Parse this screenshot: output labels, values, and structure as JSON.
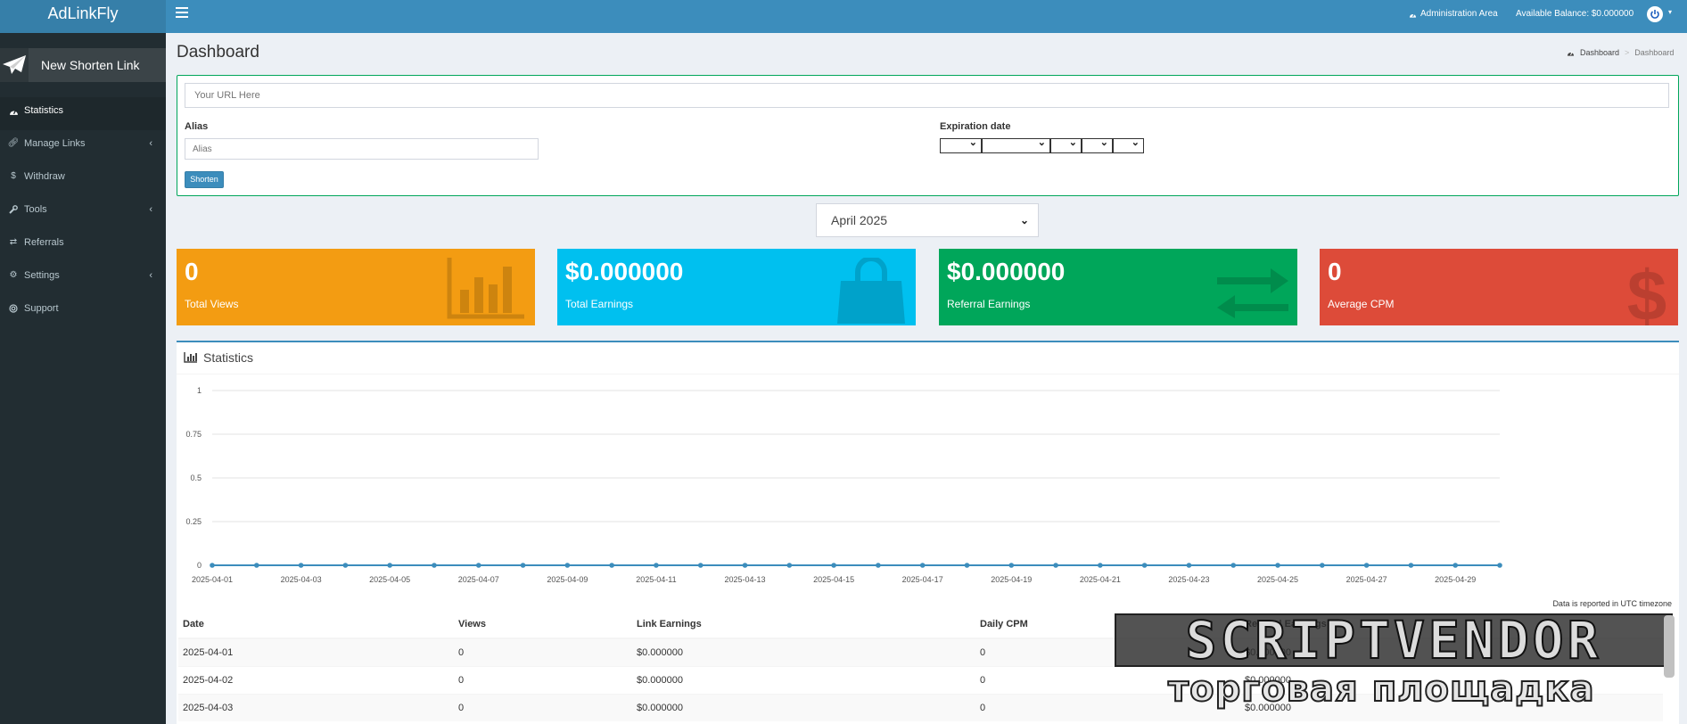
{
  "app": {
    "logo": "AdLinkFly"
  },
  "topbar": {
    "admin_area": "Administration Area",
    "balance": "Available Balance: $0.000000"
  },
  "sidebar": {
    "new_link": "New Shorten Link",
    "items": [
      {
        "label": "Statistics",
        "icon": "dashboard-icon",
        "active": true
      },
      {
        "label": "Manage Links",
        "icon": "link-icon",
        "has_submenu": true
      },
      {
        "label": "Withdraw",
        "icon": "dollar-icon"
      },
      {
        "label": "Tools",
        "icon": "wrench-icon",
        "has_submenu": true
      },
      {
        "label": "Referrals",
        "icon": "exchange-icon"
      },
      {
        "label": "Settings",
        "icon": "gears-icon",
        "has_submenu": true
      },
      {
        "label": "Support",
        "icon": "lifebuoy-icon"
      }
    ]
  },
  "page": {
    "title": "Dashboard",
    "breadcrumb": [
      "Dashboard",
      "Dashboard"
    ]
  },
  "shorten": {
    "url_placeholder": "Your URL Here",
    "alias_label": "Alias",
    "alias_placeholder": "Alias",
    "expiration_label": "Expiration date",
    "button": "Shorten"
  },
  "month_select": {
    "value": "April 2025"
  },
  "boxes": [
    {
      "value": "0",
      "label": "Total Views",
      "color": "#f39c12",
      "icon": "bar-chart-icon"
    },
    {
      "value": "$0.000000",
      "label": "Total Earnings",
      "color": "#00c0ef",
      "icon": "shopping-bag-icon"
    },
    {
      "value": "$0.000000",
      "label": "Referral Earnings",
      "color": "#00a65a",
      "icon": "exchange-icon"
    },
    {
      "value": "0",
      "label": "Average CPM",
      "color": "#dd4b39",
      "icon": "dollar-icon"
    }
  ],
  "stats": {
    "title": "Statistics",
    "utc_note": "Data is reported in UTC timezone",
    "table": {
      "headers": [
        "Date",
        "Views",
        "Link Earnings",
        "Daily CPM",
        "Referral Earnings"
      ],
      "rows": [
        [
          "2025-04-01",
          "0",
          "$0.000000",
          "0",
          "$0.000000"
        ],
        [
          "2025-04-02",
          "0",
          "$0.000000",
          "0",
          "$0.000000"
        ],
        [
          "2025-04-03",
          "0",
          "$0.000000",
          "0",
          "$0.000000"
        ]
      ]
    }
  },
  "chart_data": {
    "type": "line",
    "x": [
      "2025-04-01",
      "2025-04-02",
      "2025-04-03",
      "2025-04-04",
      "2025-04-05",
      "2025-04-06",
      "2025-04-07",
      "2025-04-08",
      "2025-04-09",
      "2025-04-10",
      "2025-04-11",
      "2025-04-12",
      "2025-04-13",
      "2025-04-14",
      "2025-04-15",
      "2025-04-16",
      "2025-04-17",
      "2025-04-18",
      "2025-04-19",
      "2025-04-20",
      "2025-04-21",
      "2025-04-22",
      "2025-04-23",
      "2025-04-24",
      "2025-04-25",
      "2025-04-26",
      "2025-04-27",
      "2025-04-28",
      "2025-04-29",
      "2025-04-30"
    ],
    "x_tick_labels": [
      "2025-04-01",
      "2025-04-03",
      "2025-04-05",
      "2025-04-07",
      "2025-04-09",
      "2025-04-11",
      "2025-04-13",
      "2025-04-15",
      "2025-04-17",
      "2025-04-19",
      "2025-04-21",
      "2025-04-23",
      "2025-04-25",
      "2025-04-27",
      "2025-04-29"
    ],
    "series": [
      {
        "values": [
          0,
          0,
          0,
          0,
          0,
          0,
          0,
          0,
          0,
          0,
          0,
          0,
          0,
          0,
          0,
          0,
          0,
          0,
          0,
          0,
          0,
          0,
          0,
          0,
          0,
          0,
          0,
          0,
          0,
          0
        ]
      }
    ],
    "y_ticks": [
      "0",
      "0.25",
      "0.5",
      "0.75",
      "1"
    ],
    "ylim": [
      0,
      1
    ],
    "grid": true,
    "line_color": "#3c8dbc"
  },
  "watermark": {
    "line1": "SCRIPTVENDOR",
    "line2": "торговая площадка"
  }
}
